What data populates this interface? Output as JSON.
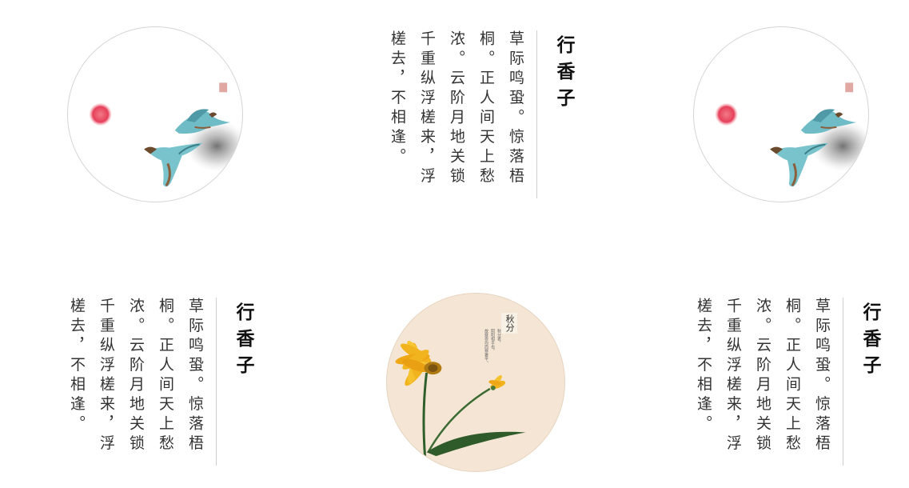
{
  "poem": {
    "title": "行香子",
    "lines": [
      "草际鸣蛩。惊落梧",
      "桐。正人间天上愁",
      "浓。云阶月地关锁",
      "千重纵浮槎来，浮",
      "槎去，不相逢。"
    ]
  },
  "autumn_card": {
    "label": "秋分",
    "caption_lines": [
      "秋分者，",
      "阴阳相半也，",
      "故昼夜均而寒暑平。"
    ]
  },
  "colors": {
    "text": "#333333",
    "divider": "#cfcfcf",
    "sun": "#e8475a",
    "bird": "#6fbcc6",
    "card_bg": "#f4e5d4",
    "petal": "#f2b41e",
    "stem": "#2e5e2a"
  }
}
